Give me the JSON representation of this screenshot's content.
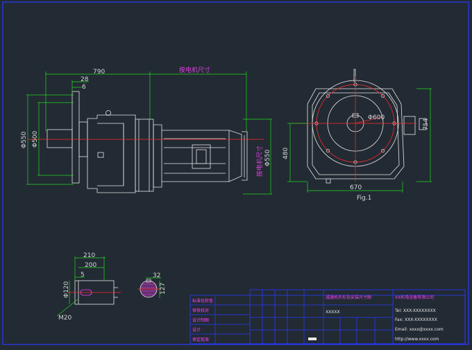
{
  "drawing": {
    "side_view": {
      "dim_overall_length": "790",
      "dim_motor_length_label": "按电机尺寸",
      "dim_flange_width": "28",
      "dim_flange_offset": "6",
      "dim_flange_diameter": "Φ550",
      "dim_spigot_diameter": "Φ500",
      "dim_motor_diameter": "Φ550",
      "dim_motor_diameter_note": "按电机尺寸"
    },
    "end_view": {
      "dim_height": "754",
      "dim_center_height": "480",
      "dim_width": "670",
      "dim_pcd": "Φ600",
      "figure_label": "Fig.1"
    },
    "shaft_detail": {
      "dim_length_total": "210",
      "dim_length_key": "200",
      "dim_shoulder": "5",
      "dim_diameter": "Φ120",
      "dim_thread": "M20",
      "dim_key_width": "32",
      "dim_key_height": "127"
    },
    "title_block": {
      "left_labels": [
        "标准化检查",
        "审核校对",
        "设计制图",
        "设计",
        "审定批准"
      ],
      "title_label": "减速机外形及安装尺寸图",
      "model_code": "XXXXX",
      "company_line1": "XX机电设备有限公司",
      "company_line2": "Tel: XXX-XXXXXXXX",
      "company_line3": "Fax: XXX-XXXXXXXX",
      "company_line4": "Email: xxxx@xxxx.com",
      "company_line5": "http://www.xxxx.com"
    }
  },
  "colors": {
    "background": "#222a33",
    "outline": "#e8e8e8",
    "dimension_line": "#22dd22",
    "dimension_text": "#d8d8d8",
    "magenta_text": "#e040e0",
    "centerline": "#ff2a2a",
    "title_block_frame": "#2a3aff"
  }
}
